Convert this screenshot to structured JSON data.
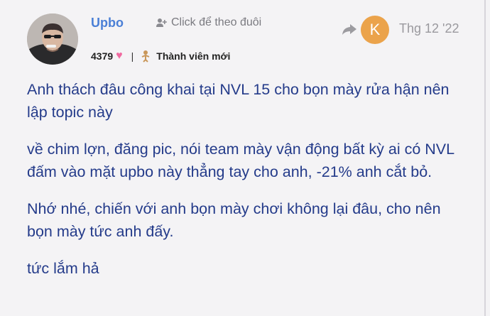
{
  "post": {
    "author": {
      "username": "Upbo",
      "likes": "4379",
      "rank": "Thành viên mới"
    },
    "follow_label": "Click để theo đuôi",
    "reply_to_avatar_letter": "K",
    "date": "Thg 12 '22",
    "paragraphs": [
      "Anh thách đâu công khai tại NVL 15 cho bọn mày rửa hận nên lập topic này",
      "về chim lợn, đăng pic, nói team mày vận động bất kỳ ai có NVL đấm vào mặt upbo này thẳng tay cho anh, -21% anh cắt bỏ.",
      "Nhớ nhé, chiến với anh bọn mày chơi không lại đâu, cho nên bọn mày tức anh đấy.",
      "tức lắm hả"
    ]
  },
  "colors": {
    "username": "#4a7fd6",
    "text": "#243b8a",
    "heart": "#f06aa0",
    "reply_avatar": "#eba34b"
  },
  "icons": [
    "user-avatar",
    "follow-icon",
    "heart-icon",
    "rank-icon",
    "reply-arrow-icon"
  ]
}
